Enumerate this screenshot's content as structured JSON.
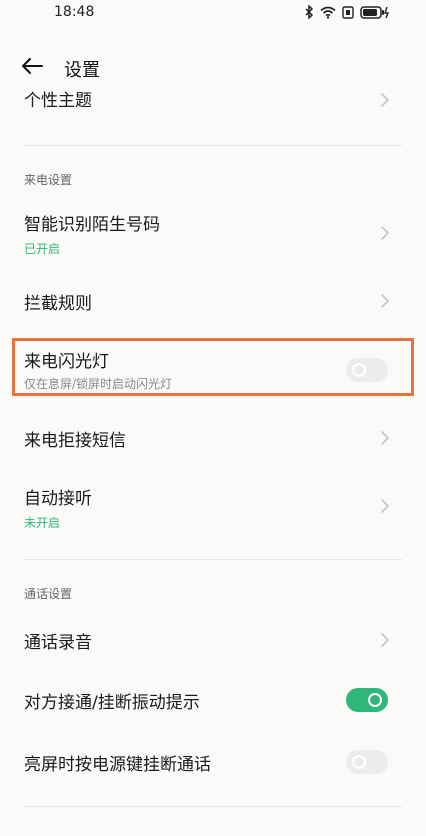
{
  "status_bar": {
    "time": "18:48",
    "icons": [
      "bluetooth-icon",
      "wifi-icon",
      "sim-icon",
      "battery-charging-icon"
    ]
  },
  "header": {
    "title": "设置",
    "back_icon": "arrow-left-icon"
  },
  "rows": {
    "theme": {
      "title": "个性主题"
    },
    "smart_id": {
      "title": "智能识别陌生号码",
      "sub": "已开启"
    },
    "block_rules": {
      "title": "拦截规则"
    },
    "flash": {
      "title": "来电闪光灯",
      "sub": "仅在息屏/锁屏时启动闪光灯",
      "toggle": false
    },
    "reject_sms": {
      "title": "来电拒接短信"
    },
    "auto_answer": {
      "title": "自动接听",
      "sub": "未开启"
    },
    "recording": {
      "title": "通话录音"
    },
    "vibrate": {
      "title": "对方接通/挂断振动提示",
      "toggle": true
    },
    "power_hangup": {
      "title": "亮屏时按电源键挂断通话",
      "toggle": false
    }
  },
  "sections": {
    "incoming": "来电设置",
    "call": "通话设置"
  },
  "colors": {
    "accent_green": "#2fb67a",
    "highlight_orange": "#e8743b"
  }
}
